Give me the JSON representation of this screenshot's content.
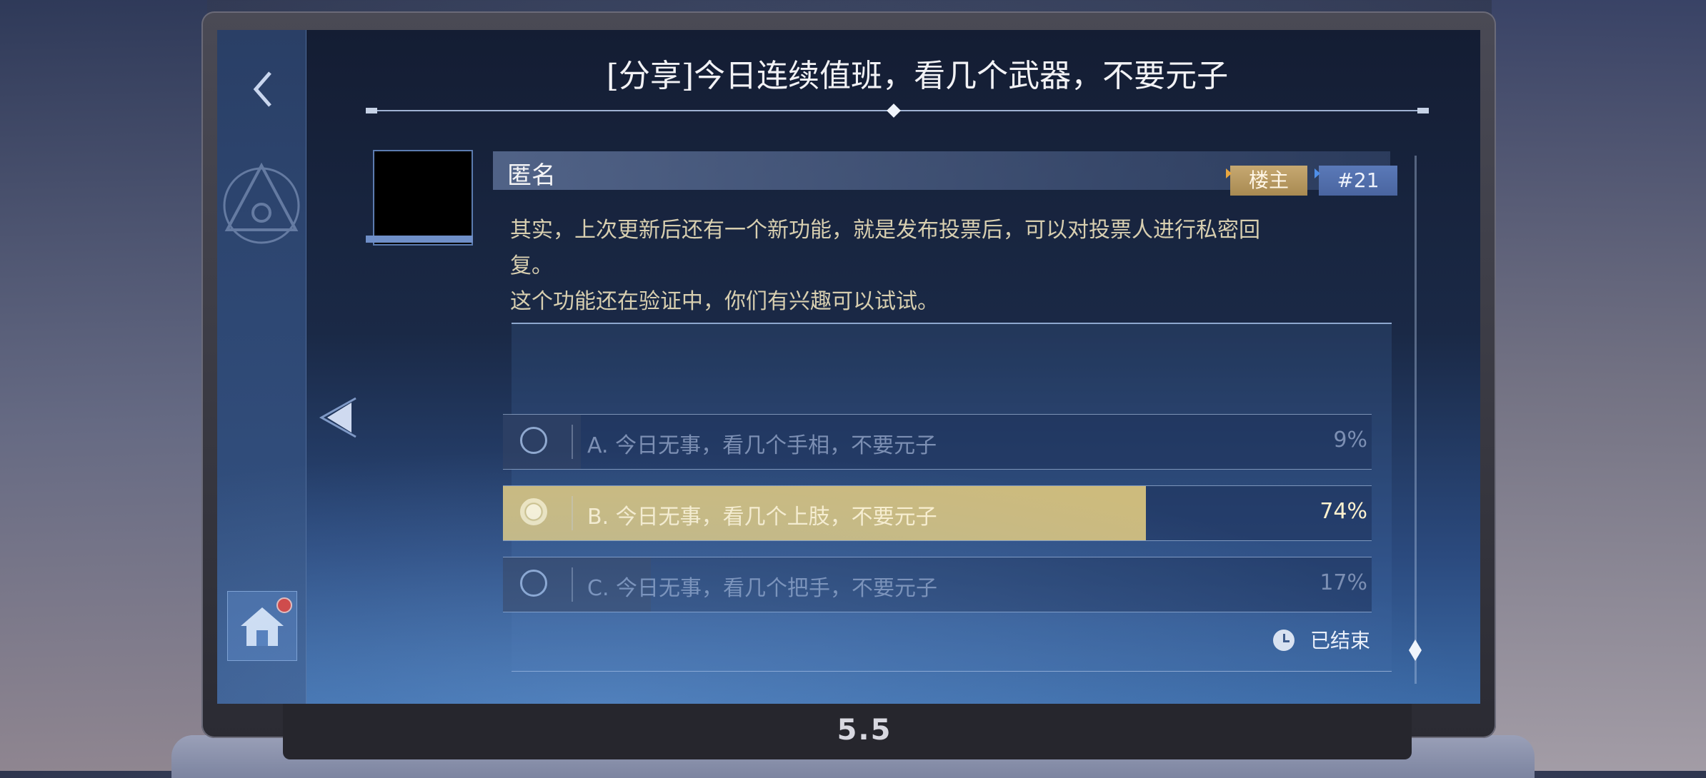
{
  "post": {
    "title": "[分享]今日连续值班，看几个武器，不要元子",
    "author": "匿名",
    "owner_tag": "楼主",
    "floor": "#21",
    "body_lines": [
      "其实，上次更新后还有一个新功能，就是发布投票后，可以对投票人进行私密回",
      "复。",
      "这个功能还在验证中，你们有兴趣可以试试。"
    ]
  },
  "poll": {
    "options": [
      {
        "label": "A.  今日无事，看几个手相，不要元子",
        "percent": "9%",
        "fraction": 0.09,
        "selected": false
      },
      {
        "label": "B.  今日无事，看几个上肢，不要元子",
        "percent": "74%",
        "fraction": 0.74,
        "selected": true
      },
      {
        "label": "C.  今日无事，看几个把手，不要元子",
        "percent": "17%",
        "fraction": 0.17,
        "selected": false
      }
    ],
    "status": "已结束"
  },
  "device": {
    "brand": "5.5"
  },
  "colors": {
    "selected_fill": "#cdbb7d",
    "unselected_fill": "#2c3f64",
    "owner_tag": "#c6a871",
    "floor_tag": "#5a79b8",
    "notification_dot": "#e0392e"
  },
  "icons": {
    "back": "chevron-left-icon",
    "home": "home-icon",
    "prev": "triangle-left-icon",
    "status": "clock-icon",
    "scroll": "diamond-icon"
  }
}
